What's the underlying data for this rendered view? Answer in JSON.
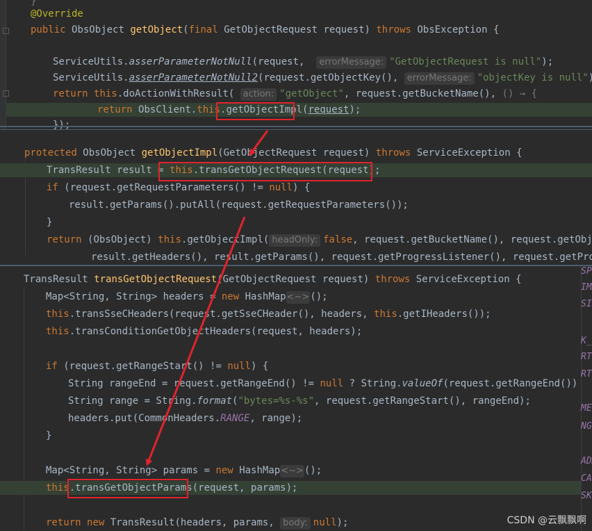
{
  "panel1": {
    "override": "@Override",
    "sig_public": "public",
    "sig_type": "ObsObject",
    "sig_method": "getObject",
    "sig_final": "final",
    "sig_params": "GetObjectRequest request)",
    "sig_throws": "throws",
    "sig_exc": "ObsException {",
    "l1_class": "ServiceUtils.",
    "l1_method": "asserParameterNotNull",
    "l1_args": "(request,",
    "l1_hint": "errorMessage:",
    "l1_str": "\"GetObjectRequest is null\"",
    "l1_end": ");",
    "l2_class": "ServiceUtils.",
    "l2_method": "asserParameterNotNull2",
    "l2_args": "(request.getObjectKey(),",
    "l2_hint": "errorMessage:",
    "l2_str": "\"objectKey is null\"",
    "l2_end": ");",
    "l3_return": "return",
    "l3_this": "this",
    "l3_call": ".doActionWithResult(",
    "l3_hint": "action:",
    "l3_str": "\"getObject\"",
    "l3_rest": ", request.getBucketName(),",
    "l3_lambda": "() → {",
    "l4_return": "return",
    "l4_class": "ObsClient.",
    "l4_this": "this",
    "l4_dot": ".",
    "l4_method": "getObjectImpl",
    "l4_paren": "(",
    "l4_arg": "request",
    "l4_end": ");",
    "l5": "});"
  },
  "panel2": {
    "sig_protected": "protected",
    "sig_type": "ObsObject",
    "sig_method": "getObjectImpl",
    "sig_params": "(GetObjectRequest request)",
    "sig_throws": "throws",
    "sig_exc": "ServiceException {",
    "l1_decl": "TransResult result =",
    "l1_this": "this",
    "l1_call": ".transGetObjectRequest(request);",
    "l2_if": "if",
    "l2_cond": "(request.getRequestParameters() !=",
    "l2_null": "null",
    "l2_end": ") {",
    "l3": "result.getParams().putAll(request.getRequestParameters());",
    "l4": "}",
    "l5_return": "return",
    "l5_cast": "(ObsObject)",
    "l5_this": "this",
    "l5_call": ".getObjectImpl(",
    "l5_hint": "headOnly:",
    "l5_false": "false",
    "l5_rest": ", request.getBucketName(), request.getObjectK",
    "l6": "result.getHeaders(), result.getParams(), request.getProgressListener(), request.getProgres"
  },
  "panel3": {
    "sig_type": "TransResult",
    "sig_method": "transGetObjectRequest",
    "sig_params": "(GetObjectRequest request)",
    "sig_throws": "throws",
    "sig_exc": "ServiceException {",
    "l1_a": "Map<String, String> headers =",
    "l1_new": "new",
    "l1_b": "HashMap",
    "l1_diamond": "<~>",
    "l1_end": "();",
    "l2_this": "this",
    "l2_a": ".transSseCHeaders(request.getSseCHeader(), headers,",
    "l2_this2": "this",
    "l2_b": ".getIHeaders());",
    "l3_this": "this",
    "l3_a": ".transConditionGetObjectHeaders(request, headers);",
    "l4_if": "if",
    "l4_a": "(request.getRangeStart() !=",
    "l4_null": "null",
    "l4_end": ") {",
    "l5_a": "String rangeEnd = request.getRangeEnd() !=",
    "l5_null": "null",
    "l5_b": "? String.",
    "l5_valueof": "valueOf",
    "l5_c": "(request.getRangeEnd()) :",
    "l5_str": "\"\"",
    "l6_a": "String range = String.",
    "l6_format": "format",
    "l6_paren": "(",
    "l6_str": "\"bytes=%s-%s\"",
    "l6_b": ", request.getRangeStart(), rangeEnd);",
    "l7_a": "headers.put(CommonHeaders.",
    "l7_const": "RANGE",
    "l7_b": ", range);",
    "l8": "}",
    "l9_a": "Map<String, String> params =",
    "l9_new": "new",
    "l9_b": "HashMap",
    "l9_diamond": "<~>",
    "l9_end": "();",
    "l10_this": "this",
    "l10_a": ".transGetObjectParams",
    "l10_b": "(request, params);",
    "l11_return": "return",
    "l11_new": "new",
    "l11_a": "TransResult(headers, params,",
    "l11_hint": "body:",
    "l11_null": "null",
    "l11_end": ");"
  },
  "side_glyphs": [
    "SP",
    "IMA",
    "SI",
    "K_",
    "RT_",
    "RT_",
    "ME",
    "NG",
    "ADA",
    "CAG",
    "SKI"
  ],
  "watermark": "CSDN @云飘飘啊",
  "colors": {
    "keyword": "#cc7832",
    "method": "#ffc66d",
    "string": "#6a8759",
    "annotation": "#bbb529",
    "constant": "#9876aa",
    "highlight_box": "#e0242c",
    "arrow": "#e0242c"
  }
}
